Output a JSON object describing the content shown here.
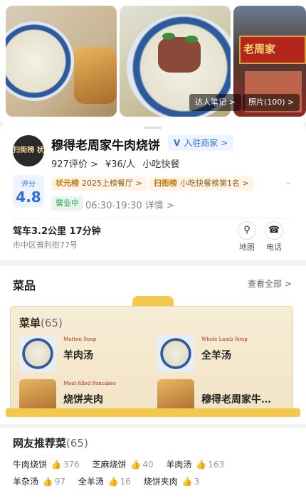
{
  "gallery": {
    "notes_label": "达人笔记 >",
    "photos_label": "照片(100) >",
    "sign_text": "老周家"
  },
  "store": {
    "badge": "扫街榜 状元",
    "name": "穆得老周家牛肉烧饼",
    "merchant_label": "入驻商家 >",
    "reviews": "927评价 >",
    "price": "¥36/人",
    "category": "小吃快餐",
    "score_label": "评分",
    "score_value": "4.8",
    "rank_badges": [
      {
        "brand": "状元榜",
        "text": "2025上榜餐厅 >"
      },
      {
        "brand": "扫街榜",
        "text": "小吃快餐榜第1名 >"
      }
    ],
    "status": "营业中",
    "hours": "06:30-19:30",
    "hours_detail": "详情 >",
    "drive": "驾车3.2公里 17分钟",
    "address": "市中区普利街77号",
    "actions": [
      {
        "label": "地图",
        "icon": "map-pin-icon"
      },
      {
        "label": "电话",
        "icon": "phone-icon"
      }
    ]
  },
  "dishes": {
    "title": "菜品",
    "see_all": "查看全部 >",
    "menu_title": "菜单",
    "menu_count": "(65)",
    "items": [
      {
        "en": "Mutton Soup",
        "cn": "羊肉汤"
      },
      {
        "en": "Whole Lamb Soup",
        "cn": "全羊汤"
      },
      {
        "en": "Meat-filled Pancakes",
        "cn": "烧饼夹肉"
      },
      {
        "en": "",
        "cn": "穆得老周家牛…"
      }
    ]
  },
  "recommended": {
    "title": "网友推荐菜",
    "count": "(65)",
    "row1": [
      {
        "name": "牛肉烧饼",
        "likes": "376"
      },
      {
        "name": "芝麻烧饼",
        "likes": "40"
      },
      {
        "name": "羊肉汤",
        "likes": "163"
      }
    ],
    "row2": [
      {
        "name": "羊杂汤",
        "likes": "97"
      },
      {
        "name": "全羊汤",
        "likes": "16"
      },
      {
        "name": "烧饼夹肉",
        "likes": "3"
      }
    ]
  }
}
